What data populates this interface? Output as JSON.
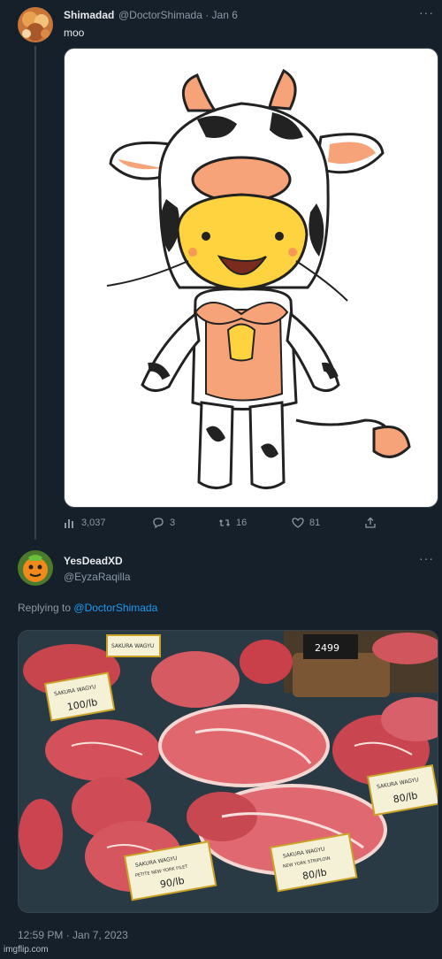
{
  "tweet1": {
    "name": "Shimadad",
    "handle": "@DoctorShimada · Jan 6",
    "text": "moo",
    "more": "···",
    "image_alt": "cartoon character in cow costume",
    "stats": {
      "views": "3,037",
      "replies": "3",
      "retweets": "16",
      "likes": "81"
    }
  },
  "tweet2": {
    "name": "YesDeadXD",
    "handle": "@EyzaRaqilla",
    "more": "···",
    "replying_prefix": "Replying to",
    "replying_mention": "@DoctorShimada",
    "image_alt": "wagyu beef display",
    "tags": {
      "t1": "SAKURA WAGYU",
      "t1b": "100/lb",
      "t2": "SAKURA WAGYU",
      "t3": "SAKURA WAGYU",
      "t3b": "80/lb",
      "t4": "SAKURA WAGYU",
      "t4b": "PETITE NEW YORK FILET",
      "t4c": "90/lb",
      "t5": "SAKURA WAGYU",
      "t5b": "NEW YORK STRIPLOIN",
      "t5c": "80/lb",
      "price_sign": "2499"
    },
    "timestamp": "12:59 PM · Jan 7, 2023"
  },
  "watermark": "imgflip.com",
  "colors": {
    "background": "#15202b",
    "text": "#e7e9ea",
    "muted": "#8b98a5",
    "accent": "#1d9bf0",
    "border": "#38444d"
  }
}
